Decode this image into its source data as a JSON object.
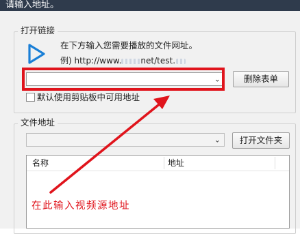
{
  "window": {
    "title": "请输入地址。"
  },
  "open_link": {
    "group_label": "打开链接",
    "hint": "在下方输入您需要播放的文件网址。",
    "example_prefix": "例) http://www.",
    "example_middle": "net/test.",
    "url_input_value": "",
    "delete_button": "删除表单",
    "clipboard_checkbox_label": "默认使用剪贴板中可用地址",
    "clipboard_checked": false
  },
  "file_address": {
    "group_label": "文件地址",
    "path_value": "",
    "open_folder_button": "打开文件夹",
    "columns": [
      "名称",
      "地址"
    ]
  },
  "annotation": {
    "text": "在此输入视频源地址",
    "color": "#e0141c"
  },
  "colors": {
    "titlebar": "#2f3b4c",
    "play_icon": "#1a7fd6",
    "highlight": "#e0141c"
  }
}
